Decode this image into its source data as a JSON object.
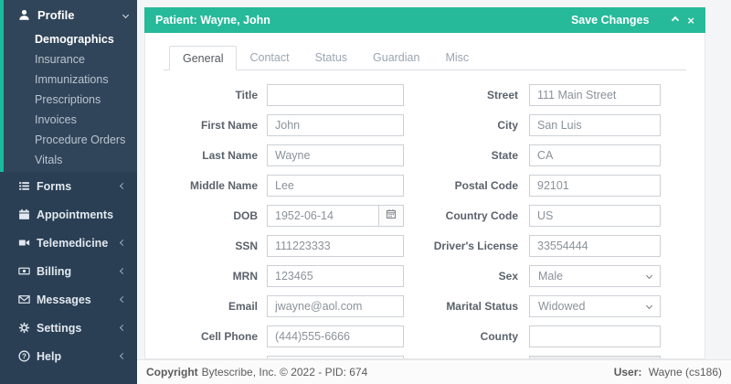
{
  "theme": {
    "accent": "#1ABB9C",
    "header-green": "#26B99A",
    "sidebar-bg": "#2A3F54",
    "page-bg": "#f4f5f7",
    "panel-border": "#e6e8eb",
    "disabled-bg": "#ededee"
  },
  "sidebar": {
    "profile": {
      "label": "Profile",
      "icon": "user-icon",
      "chevron": "down",
      "children": [
        {
          "label": "Demographics",
          "active": true
        },
        {
          "label": "Insurance"
        },
        {
          "label": "Immunizations"
        },
        {
          "label": "Prescriptions"
        },
        {
          "label": "Invoices"
        },
        {
          "label": "Procedure Orders"
        },
        {
          "label": "Vitals"
        }
      ]
    },
    "items": [
      {
        "label": "Forms",
        "icon": "list-icon",
        "chevron": "left"
      },
      {
        "label": "Appointments",
        "icon": "calendar-icon",
        "chevron": ""
      },
      {
        "label": "Telemedicine",
        "icon": "video-icon",
        "chevron": "left"
      },
      {
        "label": "Billing",
        "icon": "money-icon",
        "chevron": "left"
      },
      {
        "label": "Messages",
        "icon": "envelope-icon",
        "chevron": "left"
      },
      {
        "label": "Settings",
        "icon": "gear-icon",
        "chevron": "left"
      },
      {
        "label": "Help",
        "icon": "question-icon",
        "chevron": "left"
      }
    ]
  },
  "panel": {
    "title": "Patient: Wayne, John",
    "save_label": "Save Changes",
    "icons": {
      "collapse": "chevron-up-icon",
      "close": "close-icon",
      "close_glyph": "×"
    },
    "tabs": [
      {
        "label": "General",
        "active": true
      },
      {
        "label": "Contact"
      },
      {
        "label": "Status"
      },
      {
        "label": "Guardian"
      },
      {
        "label": "Misc"
      }
    ]
  },
  "form": {
    "left": [
      {
        "label": "Title",
        "value": ""
      },
      {
        "label": "First Name",
        "value": "John"
      },
      {
        "label": "Last Name",
        "value": "Wayne"
      },
      {
        "label": "Middle Name",
        "value": "Lee"
      },
      {
        "label": "DOB",
        "value": "1952-06-14",
        "type": "date",
        "addon_icon": "calendar-icon"
      },
      {
        "label": "SSN",
        "value": "111223333"
      },
      {
        "label": "MRN",
        "value": "123465"
      },
      {
        "label": "Email",
        "value": "jwayne@aol.com"
      },
      {
        "label": "Cell Phone",
        "value": "(444)555-6666"
      }
    ],
    "right": [
      {
        "label": "Street",
        "value": "111 Main Street"
      },
      {
        "label": "City",
        "value": "San Luis"
      },
      {
        "label": "State",
        "value": "CA"
      },
      {
        "label": "Postal Code",
        "value": "92101"
      },
      {
        "label": "Country Code",
        "value": "US"
      },
      {
        "label": "Driver's License",
        "value": "33554444"
      },
      {
        "label": "Sex",
        "value": "Male",
        "type": "select"
      },
      {
        "label": "Marital Status",
        "value": "Widowed",
        "type": "select"
      },
      {
        "label": "County",
        "value": ""
      }
    ]
  },
  "footer": {
    "copyright_label": "Copyright",
    "copyright_text": "Bytescribe, Inc. © 2022 - PID: 674",
    "user_label": "User:",
    "user_text": "Wayne (cs186)"
  }
}
